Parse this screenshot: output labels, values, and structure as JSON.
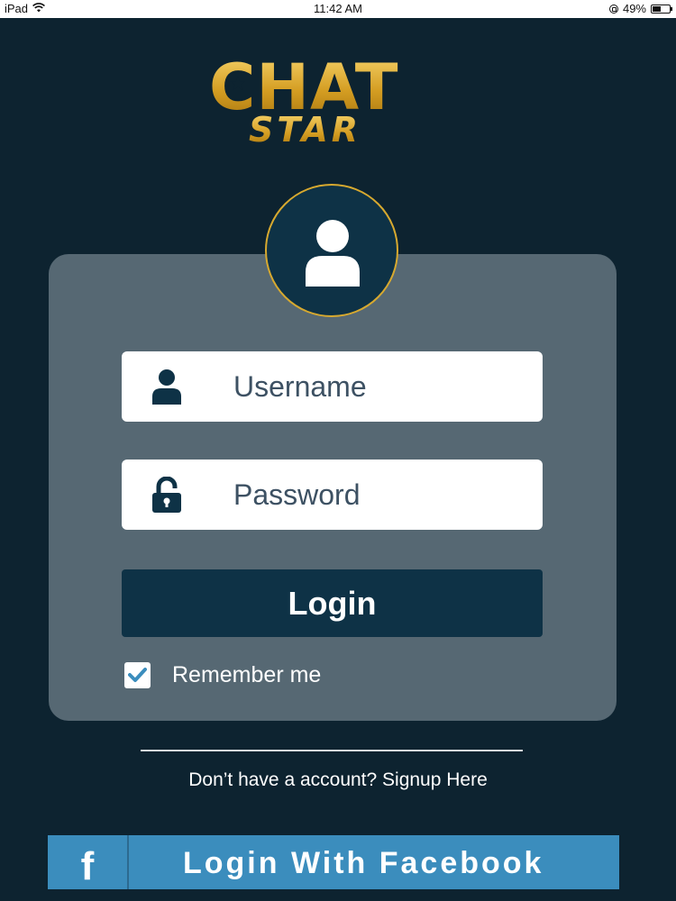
{
  "status_bar": {
    "device": "iPad",
    "time": "11:42 AM",
    "battery": "49%",
    "battery_level": 0.49,
    "icons": [
      "wifi-icon",
      "orientation-lock-icon",
      "battery-icon"
    ]
  },
  "logo": {
    "line1": "CHAT",
    "line2": "STAR",
    "star_glyph": "★",
    "colors": {
      "gold": "#d9a62c",
      "gold_light": "#f6d36a"
    }
  },
  "login_form": {
    "username_placeholder": "Username",
    "password_placeholder": "Password",
    "login_label": "Login",
    "remember_label": "Remember me",
    "remember_checked": true
  },
  "signup": {
    "text": "Don’t have a account? Signup Here"
  },
  "facebook": {
    "icon_glyph": "f",
    "label": "Login With Facebook"
  },
  "colors": {
    "background": "#0d2330",
    "card": "#566873",
    "primary": "#0e3246",
    "avatar_ring": "#d7a92f",
    "facebook_blue": "#3b8dbd"
  }
}
